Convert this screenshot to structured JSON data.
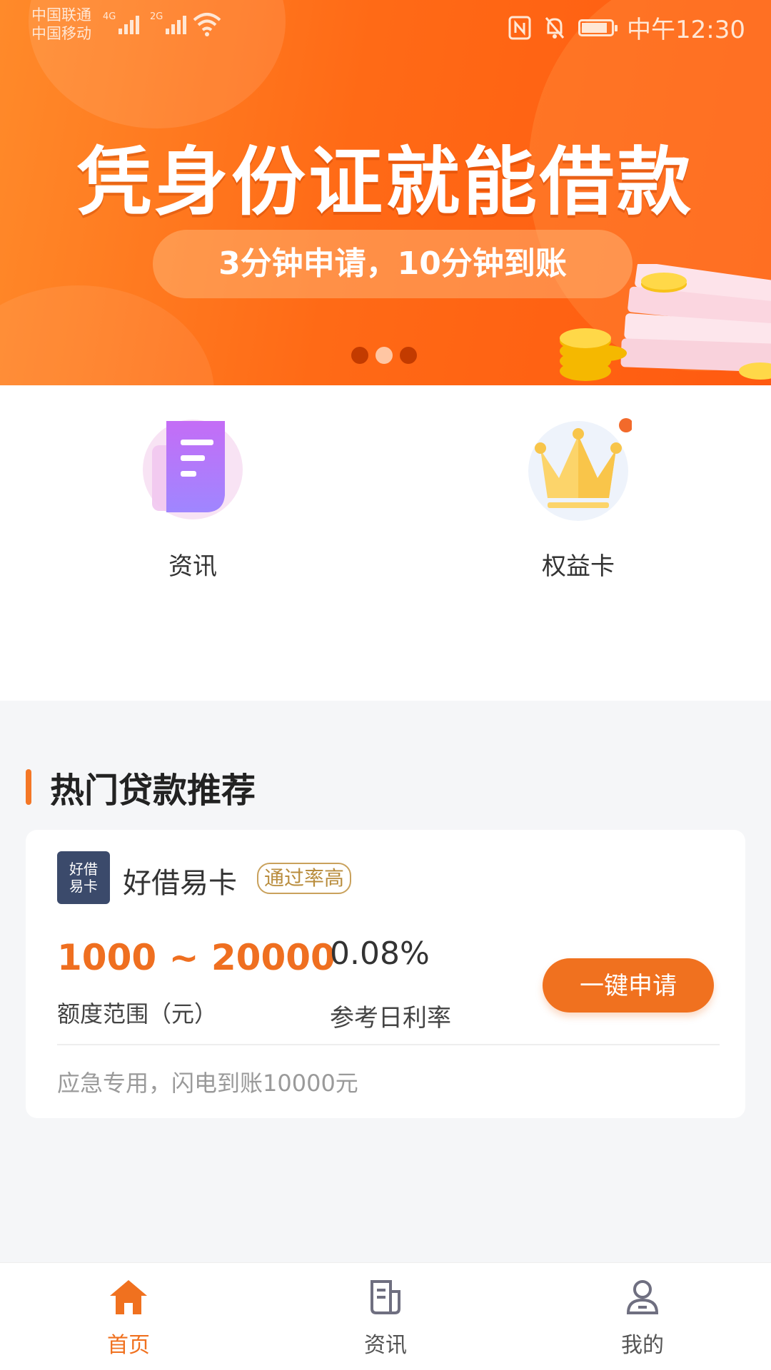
{
  "status_bar": {
    "carrier1": "中国联通",
    "carrier2": "中国移动",
    "net1": "4G",
    "net2": "2G",
    "time": "中午12:30"
  },
  "banner": {
    "title": "凭身份证就能借款",
    "subtitle": "3分钟申请，10分钟到账",
    "slides": 3,
    "active_slide": 2
  },
  "quick_entries": [
    {
      "label": "资讯",
      "icon": "document-icon"
    },
    {
      "label": "权益卡",
      "icon": "crown-icon"
    }
  ],
  "section": {
    "title": "热门贷款推荐"
  },
  "loan_card": {
    "logo_text_1": "好借",
    "logo_text_2": "易卡",
    "name": "好借易卡",
    "badge": "通过率高",
    "amount_range": "1000 ~ 20000",
    "amount_label": "额度范围（元）",
    "rate": "0.08%",
    "rate_label": "参考日利率",
    "apply_label": "一键申请",
    "note": "应急专用，闪电到账10000元"
  },
  "tabbar": {
    "items": [
      {
        "label": "首页",
        "icon": "home-icon",
        "active": true
      },
      {
        "label": "资讯",
        "icon": "news-icon",
        "active": false
      },
      {
        "label": "我的",
        "icon": "profile-icon",
        "active": false
      }
    ]
  },
  "colors": {
    "accent": "#f0711f",
    "banner_orange": "#ff6a16",
    "logo_bg": "#3b4a6b"
  }
}
